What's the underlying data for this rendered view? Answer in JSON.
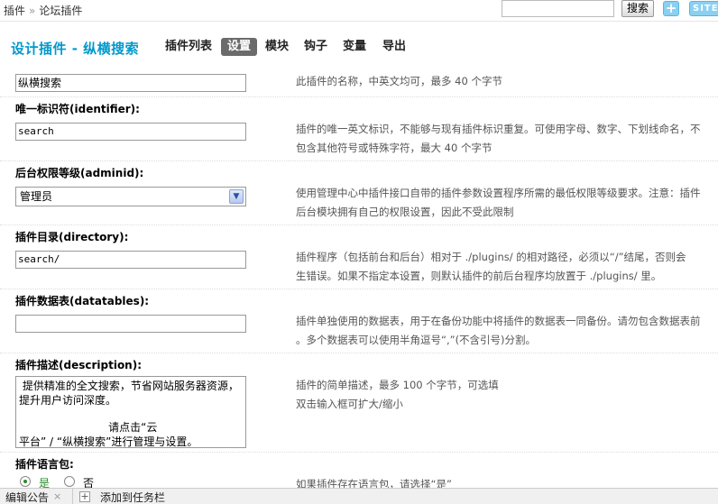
{
  "breadcrumb": {
    "root": "插件",
    "sep": "»",
    "current": "论坛插件"
  },
  "topbar": {
    "search_placeholder": "",
    "search_label": "搜索",
    "add_label": "+",
    "site_label": "SITE"
  },
  "title": "设计插件 - 纵横搜索",
  "tabs": [
    "插件列表",
    "设置",
    "模块",
    "钩子",
    "变量",
    "导出"
  ],
  "active_tab": "设置",
  "fields": {
    "name": {
      "value": "纵横搜索",
      "desc": "此插件的名称，中英文均可，最多 40 个字节"
    },
    "identifier": {
      "label": "唯一标识符(identifier):",
      "value": "search",
      "desc1": "插件的唯一英文标识，不能够与现有插件标识重复。可使用字母、数字、下划线命名，不",
      "desc2": "包含其他符号或特殊字符，最大 40 个字节"
    },
    "adminid": {
      "label": "后台权限等级(adminid):",
      "value": "管理员",
      "desc1": "使用管理中心中插件接口自带的插件参数设置程序所需的最低权限等级要求。注意：插件",
      "desc2": "后台模块拥有自己的权限设置，因此不受此限制"
    },
    "directory": {
      "label": "插件目录(directory):",
      "value": "search/",
      "desc1": "插件程序（包括前台和后台）相对于 ./plugins/ 的相对路径，必须以“/”结尾，否则会",
      "desc2": "生错误。如果不指定本设置，则默认插件的前后台程序均放置于 ./plugins/ 里。"
    },
    "datatables": {
      "label": "插件数据表(datatables):",
      "value": "",
      "desc1": "插件单独使用的数据表，用于在备份功能中将插件的数据表一同备份。请勿包含数据表前",
      "desc2": "。多个数据表可以使用半角逗号“,”(不含引号)分割。"
    },
    "description": {
      "label": "插件描述(description):",
      "line1": " 提供精准的全文搜索，节省网站服务器资源，",
      "line2": "提升用户访问深度。",
      "line3": "                          请点击“云",
      "line4": "平台” / “纵横搜索”进行管理与设置。",
      "desc1": "插件的简单描述，最多 100 个字节，可选填",
      "desc2": "双击输入框可扩大/缩小"
    },
    "langpack": {
      "label": "插件语言包:",
      "yes": "是",
      "no": "否",
      "desc": "如果插件存在语言包，请选择“是”"
    }
  },
  "bottombar": {
    "item1": "编辑公告",
    "close": "×",
    "plus": "+",
    "item2": "添加到任务栏"
  }
}
